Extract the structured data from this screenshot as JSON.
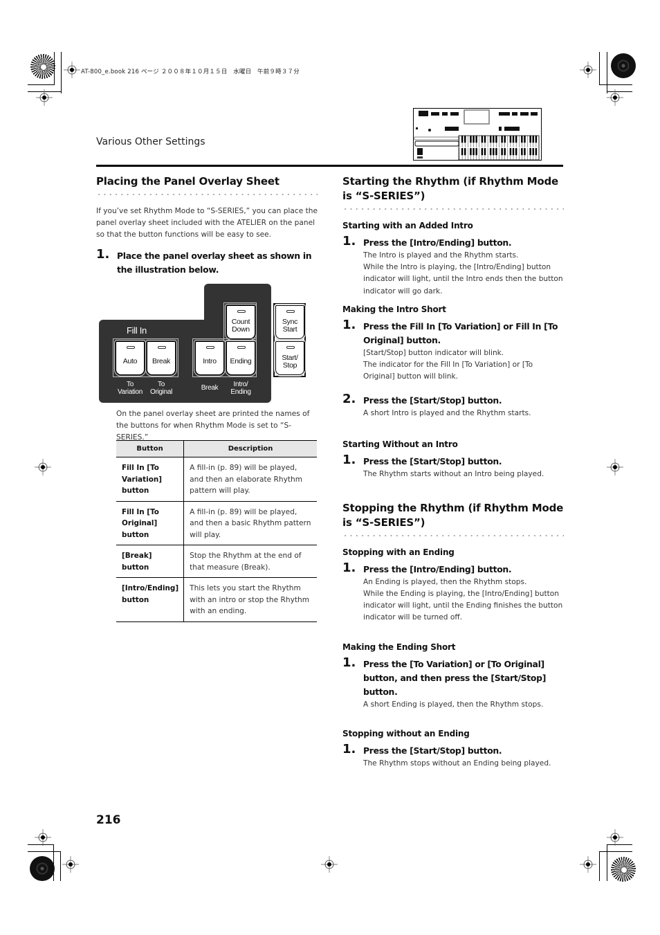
{
  "print_slug": "AT-800_e.book  216 ページ  ２００８年１０月１５日　水曜日　午前９時３７分",
  "header": {
    "section_label": "Various Other Settings",
    "illustration": "keyboard-panel-illustration"
  },
  "left": {
    "heading": "Placing the Panel Overlay Sheet",
    "intro": "If you’ve set Rhythm Mode to “S-SERIES,” you can place the panel overlay sheet included with the ATELIER on the panel so that the button functions will be easy to see.",
    "step": {
      "num": "1.",
      "title": "Place the panel overlay sheet as shown in the illustration below."
    },
    "panel": {
      "group_title": "Fill In",
      "buttons": [
        {
          "id": "auto",
          "label": "Auto",
          "sub": "To\nVariation"
        },
        {
          "id": "break",
          "label": "Break",
          "sub": "To\nOriginal"
        },
        {
          "id": "intro",
          "label": "Intro",
          "sub": "Break"
        },
        {
          "id": "ending",
          "label": "Ending",
          "sub": "Intro/\nEnding"
        },
        {
          "id": "count-down",
          "label": "Count\nDown"
        },
        {
          "id": "sync-start",
          "label": "Sync\nStart"
        },
        {
          "id": "start-stop",
          "label": "Start/\nStop"
        }
      ]
    },
    "note": "On the panel overlay sheet are printed the names of the buttons for when Rhythm Mode is set to “S-SERIES.”",
    "table": {
      "headers": [
        "Button",
        "Description"
      ],
      "rows": [
        {
          "button": "Fill In [To Variation] button",
          "description": "A fill-in (p. 89) will be played, and then an elaborate Rhythm pattern will play."
        },
        {
          "button": "Fill In [To Original] button",
          "description": "A fill-in (p. 89) will be played, and then a basic Rhythm pattern will play."
        },
        {
          "button": "[Break] button",
          "description": "Stop the Rhythm at the end of that measure (Break)."
        },
        {
          "button": "[Intro/Ending] button",
          "description": "This lets you start the Rhythm with an intro or stop the Rhythm with an ending."
        }
      ]
    }
  },
  "right": {
    "start_heading": "Starting the Rhythm (if Rhythm Mode is “S-SERIES”)",
    "start_sections": [
      {
        "title": "Starting with an Added Intro",
        "steps": [
          {
            "num": "1.",
            "title": "Press the [Intro/Ending] button.",
            "desc": [
              "The Intro is played and the Rhythm starts.",
              "While the Intro is playing, the [Intro/Ending] button indicator will light, until the Intro ends then the button indicator will go dark."
            ]
          }
        ]
      },
      {
        "title": "Making the Intro Short",
        "steps": [
          {
            "num": "1.",
            "title": "Press the Fill In [To Variation] or Fill In [To Original] button.",
            "desc": [
              "[Start/Stop] button indicator will blink.",
              "The indicator for the Fill In [To Variation] or [To Original] button will blink."
            ]
          },
          {
            "num": "2.",
            "title": "Press the [Start/Stop] button.",
            "desc": [
              "A short Intro is played and the Rhythm starts."
            ]
          }
        ]
      },
      {
        "title": "Starting Without an Intro",
        "steps": [
          {
            "num": "1.",
            "title": "Press the [Start/Stop] button.",
            "desc": [
              "The Rhythm starts without an Intro being played."
            ]
          }
        ]
      }
    ],
    "stop_heading": "Stopping the Rhythm (if Rhythm Mode is “S-SERIES”)",
    "stop_sections": [
      {
        "title": "Stopping with an Ending",
        "steps": [
          {
            "num": "1.",
            "title": "Press the [Intro/Ending] button.",
            "desc": [
              "An Ending is played, then the Rhythm stops.",
              "While the Ending is playing, the [Intro/Ending] button indicator will light, until the Ending finishes the button indicator will be turned off."
            ]
          }
        ]
      },
      {
        "title": "Making the Ending Short",
        "steps": [
          {
            "num": "1.",
            "title": "Press the [To Variation] or [To Original] button, and then press the [Start/Stop] button.",
            "desc": [
              "A short Ending is played, then the Rhythm stops."
            ]
          }
        ]
      },
      {
        "title": "Stopping without an Ending",
        "steps": [
          {
            "num": "1.",
            "title": "Press the [Start/Stop] button.",
            "desc": [
              "The Rhythm stops without an Ending being played."
            ]
          }
        ]
      }
    ]
  },
  "footer": {
    "page_number": "216"
  }
}
